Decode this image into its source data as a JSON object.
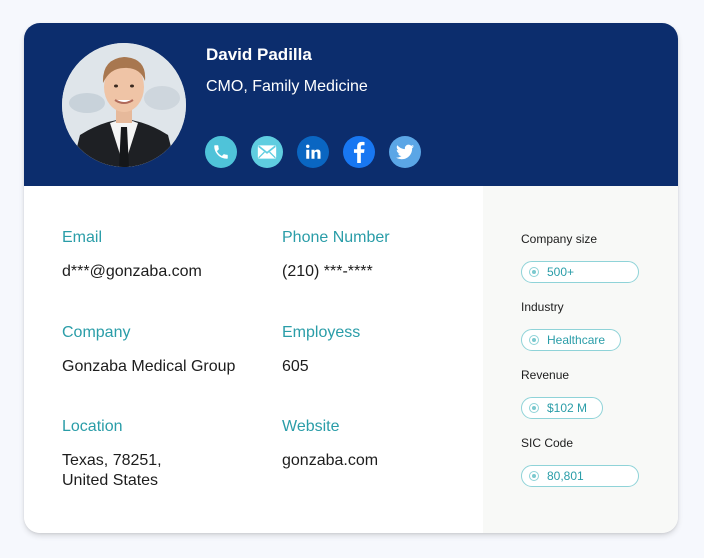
{
  "profile": {
    "name": "David Padilla",
    "title": "CMO, Family Medicine",
    "avatar_alt": "profile-photo"
  },
  "socials": [
    {
      "icon": "phone-icon",
      "color": "#4fc3d9"
    },
    {
      "icon": "email-icon",
      "color": "#5fcde0"
    },
    {
      "icon": "linkedin-icon",
      "color": "#0a66c2"
    },
    {
      "icon": "facebook-icon",
      "color": "#1877f2"
    },
    {
      "icon": "twitter-icon",
      "color": "#5ba6e6"
    }
  ],
  "details": {
    "email": {
      "label": "Email",
      "value": "d***@gonzaba.com"
    },
    "phone": {
      "label": "Phone Number",
      "value": "(210) ***-****"
    },
    "company": {
      "label": "Company",
      "value": "Gonzaba Medical Group"
    },
    "employees": {
      "label": "Employess",
      "value": "605"
    },
    "location": {
      "label": "Location",
      "value": "Texas, 78251,\nUnited States"
    },
    "website": {
      "label": "Website",
      "value": "gonzaba.com"
    }
  },
  "sidebar": {
    "company_size": {
      "label": "Company size",
      "value": "500+"
    },
    "industry": {
      "label": "Industry",
      "value": "Healthcare"
    },
    "revenue": {
      "label": "Revenue",
      "value": "$102 M"
    },
    "sic_code": {
      "label": "SIC Code",
      "value": "80,801"
    }
  },
  "colors": {
    "header_bg": "#0c2d6d",
    "label_accent": "#2a9da8",
    "pill_border": "#8fd3d8"
  }
}
